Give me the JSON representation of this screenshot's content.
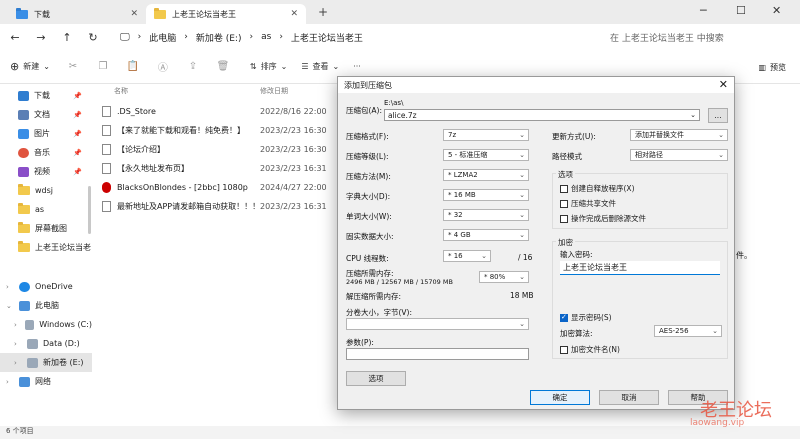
{
  "tabs": [
    {
      "label": "下载"
    },
    {
      "label": "上老王论坛当老王"
    }
  ],
  "window_controls": {
    "minimize": "─",
    "maximize": "☐",
    "close": "✕"
  },
  "address": {
    "crumbs": [
      "此电脑",
      "新加卷 (E:)",
      "as",
      "上老王论坛当老王"
    ],
    "search_placeholder": "在 上老王论坛当老王 中搜索"
  },
  "toolbar": {
    "new_label": "新建",
    "sort_label": "排序",
    "view_label": "查看",
    "more_label": "···",
    "preview_label": "预览"
  },
  "sidebar": {
    "quick": [
      {
        "label": "下载",
        "icon": "download-icon",
        "color": "#2f7dd0"
      },
      {
        "label": "文档",
        "icon": "document-icon",
        "color": "#5b7fb5"
      },
      {
        "label": "图片",
        "icon": "picture-icon",
        "color": "#3a8ee6"
      },
      {
        "label": "音乐",
        "icon": "music-icon",
        "color": "#e0543f"
      },
      {
        "label": "视频",
        "icon": "video-icon",
        "color": "#8a4fc8"
      },
      {
        "label": "wdsj",
        "icon": "folder-icon",
        "color": "#f2c94c"
      },
      {
        "label": "as",
        "icon": "folder-icon",
        "color": "#f2c94c"
      },
      {
        "label": "屏幕截图",
        "icon": "folder-icon",
        "color": "#f2c94c"
      },
      {
        "label": "上老王论坛当老",
        "icon": "folder-icon",
        "color": "#f2c94c"
      }
    ],
    "tree": [
      {
        "label": "OneDrive",
        "icon": "cloud-icon"
      },
      {
        "label": "此电脑",
        "icon": "pc-icon"
      },
      {
        "label": "Windows (C:)",
        "icon": "drive-icon"
      },
      {
        "label": "Data (D:)",
        "icon": "drive-icon"
      },
      {
        "label": "新加卷 (E:)",
        "icon": "drive-icon"
      },
      {
        "label": "网络",
        "icon": "network-icon"
      }
    ]
  },
  "files": {
    "headers": {
      "name": "名称",
      "date": "修改日期"
    },
    "rows": [
      {
        "name": ".DS_Store",
        "date": "2022/8/16 22:00"
      },
      {
        "name": "【来了就能下载和观看！纯免费！】",
        "date": "2023/2/23 16:30"
      },
      {
        "name": "【论坛介绍】",
        "date": "2023/2/23 16:30"
      },
      {
        "name": "【永久地址发布页】",
        "date": "2023/2/23 16:31"
      },
      {
        "name": "BlacksOnBlondes - [2bbc] 1080p",
        "date": "2024/4/27 22:00"
      },
      {
        "name": "最新地址及APP请发邮箱自动获取！！！",
        "date": "2023/2/23 16:31"
      }
    ],
    "peek_right": "件。"
  },
  "status": {
    "count": "6 个项目"
  },
  "dialog": {
    "title": "添加到压缩包",
    "archive_label": "压缩包(A):",
    "archive_path": "E:\\as\\",
    "archive_name": "alice.7z",
    "browse": "...",
    "format_label": "压缩格式(F):",
    "format": "7z",
    "level_label": "压缩等级(L):",
    "level": "5 - 标准压缩",
    "method_label": "压缩方法(M):",
    "method": "* LZMA2",
    "dict_label": "字典大小(D):",
    "dict": "* 16 MB",
    "word_label": "单词大小(W):",
    "word": "* 32",
    "solid_label": "固实数据大小:",
    "solid": "* 4 GB",
    "threads_label": "CPU 线程数:",
    "threads": "* 16",
    "threads_max": "/ 16",
    "mem_comp_label": "压缩所需内存:",
    "mem_comp_detail": "2496 MB / 12567 MB / 15709 MB",
    "mem_percent": "* 80%",
    "mem_decomp_label": "解压缩所需内存:",
    "mem_decomp": "18 MB",
    "split_label": "分卷大小，字节(V):",
    "params_label": "参数(P):",
    "options_button": "选项",
    "update_label": "更新方式(U):",
    "update": "添加并替换文件",
    "pathmode_label": "路径模式",
    "pathmode": "相对路径",
    "opts_title": "选项",
    "opt_sfx": "创建自释放程序(X)",
    "opt_shared": "压缩共享文件",
    "opt_delete": "操作完成后删除源文件",
    "enc_title": "加密",
    "pwd_label": "输入密码:",
    "pwd_value": "上老王论坛当老王",
    "show_pwd": "显示密码(S)",
    "enc_method_label": "加密算法:",
    "enc_method": "AES-256",
    "enc_names": "加密文件名(N)",
    "ok": "确定",
    "cancel": "取消",
    "help": "帮助"
  },
  "watermark": {
    "title": "老王论坛",
    "url": "laowang.vip"
  }
}
